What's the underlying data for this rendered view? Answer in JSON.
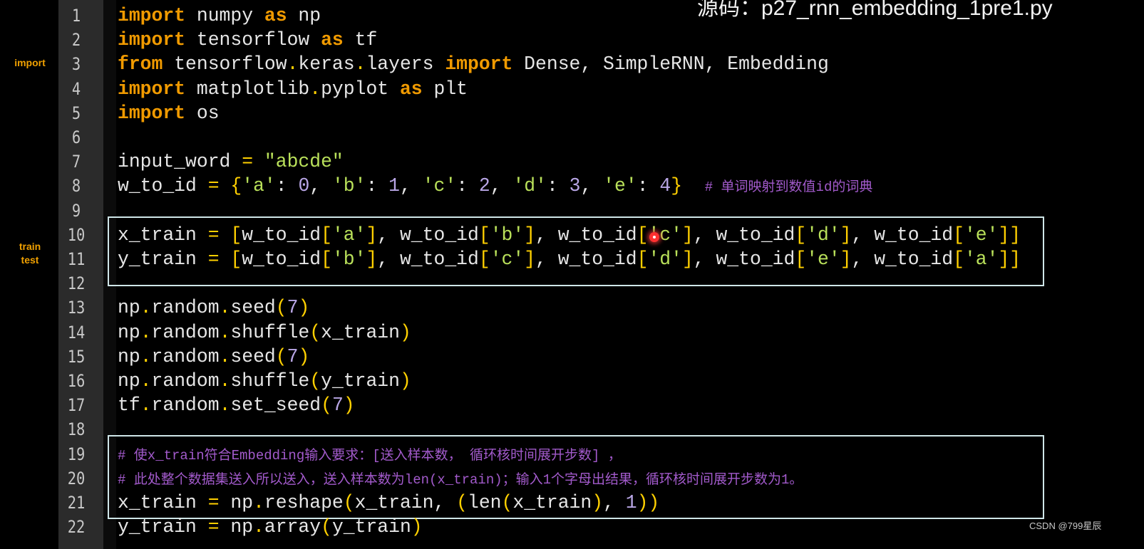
{
  "title": "源码：p27_rnn_embedding_1pre1.py",
  "side_labels": {
    "import": "import",
    "train": "train",
    "test": "test"
  },
  "watermark": "CSDN @799星辰",
  "colors": {
    "keyword": "#f09a00",
    "string": "#b9e05a",
    "bracket": "#ffd000",
    "number": "#b9a6e6",
    "comment": "#a25acb",
    "box": "#cfe6e8",
    "gutter": "#2b2b2b"
  },
  "lines": [
    {
      "n": "1",
      "t": [
        [
          "kw",
          "import"
        ],
        [
          "pl",
          " numpy "
        ],
        [
          "kw",
          "as"
        ],
        [
          "pl",
          " np"
        ]
      ]
    },
    {
      "n": "2",
      "t": [
        [
          "kw",
          "import"
        ],
        [
          "pl",
          " tensorflow "
        ],
        [
          "kw",
          "as"
        ],
        [
          "pl",
          " tf"
        ]
      ]
    },
    {
      "n": "3",
      "t": [
        [
          "kw",
          "from"
        ],
        [
          "pl",
          " tensorflow"
        ],
        [
          "op",
          "."
        ],
        [
          "pl",
          "keras"
        ],
        [
          "op",
          "."
        ],
        [
          "pl",
          "layers "
        ],
        [
          "kw",
          "import"
        ],
        [
          "pl",
          " Dense, SimpleRNN, Embedding"
        ]
      ]
    },
    {
      "n": "4",
      "t": [
        [
          "kw",
          "import"
        ],
        [
          "pl",
          " matplotlib"
        ],
        [
          "op",
          "."
        ],
        [
          "pl",
          "pyplot "
        ],
        [
          "kw",
          "as"
        ],
        [
          "pl",
          " plt"
        ]
      ]
    },
    {
      "n": "5",
      "t": [
        [
          "kw",
          "import"
        ],
        [
          "pl",
          " os"
        ]
      ]
    },
    {
      "n": "6",
      "t": []
    },
    {
      "n": "7",
      "t": [
        [
          "pl",
          "input_word "
        ],
        [
          "op",
          "="
        ],
        [
          "pl",
          " "
        ],
        [
          "str",
          "\"abcde\""
        ]
      ]
    },
    {
      "n": "8",
      "t": [
        [
          "pl",
          "w_to_id "
        ],
        [
          "op",
          "="
        ],
        [
          "pl",
          " "
        ],
        [
          "br",
          "{"
        ],
        [
          "str",
          "'a'"
        ],
        [
          "pl",
          ": "
        ],
        [
          "num",
          "0"
        ],
        [
          "pl",
          ", "
        ],
        [
          "str",
          "'b'"
        ],
        [
          "pl",
          ": "
        ],
        [
          "num",
          "1"
        ],
        [
          "pl",
          ", "
        ],
        [
          "str",
          "'c'"
        ],
        [
          "pl",
          ": "
        ],
        [
          "num",
          "2"
        ],
        [
          "pl",
          ", "
        ],
        [
          "str",
          "'d'"
        ],
        [
          "pl",
          ": "
        ],
        [
          "num",
          "3"
        ],
        [
          "pl",
          ", "
        ],
        [
          "str",
          "'e'"
        ],
        [
          "pl",
          ": "
        ],
        [
          "num",
          "4"
        ],
        [
          "br",
          "}"
        ],
        [
          "pl",
          "  "
        ],
        [
          "cm",
          "# 单词映射到数值id的词典"
        ]
      ]
    },
    {
      "n": "9",
      "t": []
    },
    {
      "n": "10",
      "t": [
        [
          "pl",
          "x_train "
        ],
        [
          "op",
          "="
        ],
        [
          "pl",
          " "
        ],
        [
          "br",
          "["
        ],
        [
          "pl",
          "w_to_id"
        ],
        [
          "br",
          "["
        ],
        [
          "str",
          "'a'"
        ],
        [
          "br",
          "]"
        ],
        [
          "pl",
          ", w_to_id"
        ],
        [
          "br",
          "["
        ],
        [
          "str",
          "'b'"
        ],
        [
          "br",
          "]"
        ],
        [
          "pl",
          ", w_to_id"
        ],
        [
          "br",
          "["
        ],
        [
          "str",
          "'c'"
        ],
        [
          "br",
          "]"
        ],
        [
          "pl",
          ", w_to_id"
        ],
        [
          "br",
          "["
        ],
        [
          "str",
          "'d'"
        ],
        [
          "br",
          "]"
        ],
        [
          "pl",
          ", w_to_id"
        ],
        [
          "br",
          "["
        ],
        [
          "str",
          "'e'"
        ],
        [
          "br",
          "]]"
        ]
      ]
    },
    {
      "n": "11",
      "t": [
        [
          "pl",
          "y_train "
        ],
        [
          "op",
          "="
        ],
        [
          "pl",
          " "
        ],
        [
          "br",
          "["
        ],
        [
          "pl",
          "w_to_id"
        ],
        [
          "br",
          "["
        ],
        [
          "str",
          "'b'"
        ],
        [
          "br",
          "]"
        ],
        [
          "pl",
          ", w_to_id"
        ],
        [
          "br",
          "["
        ],
        [
          "str",
          "'c'"
        ],
        [
          "br",
          "]"
        ],
        [
          "pl",
          ", w_to_id"
        ],
        [
          "br",
          "["
        ],
        [
          "str",
          "'d'"
        ],
        [
          "br",
          "]"
        ],
        [
          "pl",
          ", w_to_id"
        ],
        [
          "br",
          "["
        ],
        [
          "str",
          "'e'"
        ],
        [
          "br",
          "]"
        ],
        [
          "pl",
          ", w_to_id"
        ],
        [
          "br",
          "["
        ],
        [
          "str",
          "'a'"
        ],
        [
          "br",
          "]]"
        ]
      ]
    },
    {
      "n": "12",
      "t": []
    },
    {
      "n": "13",
      "t": [
        [
          "pl",
          "np"
        ],
        [
          "op",
          "."
        ],
        [
          "pl",
          "random"
        ],
        [
          "op",
          "."
        ],
        [
          "pl",
          "seed"
        ],
        [
          "br",
          "("
        ],
        [
          "num",
          "7"
        ],
        [
          "br",
          ")"
        ]
      ]
    },
    {
      "n": "14",
      "t": [
        [
          "pl",
          "np"
        ],
        [
          "op",
          "."
        ],
        [
          "pl",
          "random"
        ],
        [
          "op",
          "."
        ],
        [
          "pl",
          "shuffle"
        ],
        [
          "br",
          "("
        ],
        [
          "pl",
          "x_train"
        ],
        [
          "br",
          ")"
        ]
      ]
    },
    {
      "n": "15",
      "t": [
        [
          "pl",
          "np"
        ],
        [
          "op",
          "."
        ],
        [
          "pl",
          "random"
        ],
        [
          "op",
          "."
        ],
        [
          "pl",
          "seed"
        ],
        [
          "br",
          "("
        ],
        [
          "num",
          "7"
        ],
        [
          "br",
          ")"
        ]
      ]
    },
    {
      "n": "16",
      "t": [
        [
          "pl",
          "np"
        ],
        [
          "op",
          "."
        ],
        [
          "pl",
          "random"
        ],
        [
          "op",
          "."
        ],
        [
          "pl",
          "shuffle"
        ],
        [
          "br",
          "("
        ],
        [
          "pl",
          "y_train"
        ],
        [
          "br",
          ")"
        ]
      ]
    },
    {
      "n": "17",
      "t": [
        [
          "pl",
          "tf"
        ],
        [
          "op",
          "."
        ],
        [
          "pl",
          "random"
        ],
        [
          "op",
          "."
        ],
        [
          "pl",
          "set_seed"
        ],
        [
          "br",
          "("
        ],
        [
          "num",
          "7"
        ],
        [
          "br",
          ")"
        ]
      ]
    },
    {
      "n": "18",
      "t": []
    },
    {
      "n": "19",
      "t": [
        [
          "cm",
          "# 使x_train符合Embedding输入要求：[送入样本数， 循环核时间展开步数] ，"
        ]
      ]
    },
    {
      "n": "20",
      "t": [
        [
          "cm",
          "# 此处整个数据集送入所以送入，送入样本数为len(x_train)；输入1个字母出结果，循环核时间展开步数为1。"
        ]
      ]
    },
    {
      "n": "21",
      "t": [
        [
          "pl",
          "x_train "
        ],
        [
          "op",
          "="
        ],
        [
          "pl",
          " np"
        ],
        [
          "op",
          "."
        ],
        [
          "pl",
          "reshape"
        ],
        [
          "br",
          "("
        ],
        [
          "pl",
          "x_train, "
        ],
        [
          "br",
          "("
        ],
        [
          "pl",
          "len"
        ],
        [
          "br",
          "("
        ],
        [
          "pl",
          "x_train"
        ],
        [
          "br",
          ")"
        ],
        [
          "pl",
          ", "
        ],
        [
          "num",
          "1"
        ],
        [
          "br",
          "))"
        ]
      ]
    },
    {
      "n": "22",
      "t": [
        [
          "pl",
          "y_train "
        ],
        [
          "op",
          "="
        ],
        [
          "pl",
          " np"
        ],
        [
          "op",
          "."
        ],
        [
          "pl",
          "array"
        ],
        [
          "br",
          "("
        ],
        [
          "pl",
          "y_train"
        ],
        [
          "br",
          ")"
        ]
      ]
    }
  ]
}
